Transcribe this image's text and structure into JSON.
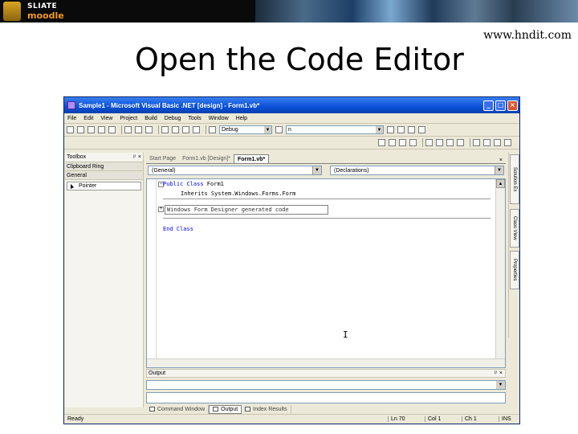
{
  "banner": {
    "logo_top": "SLIATE",
    "logo_bottom": "moodle"
  },
  "site_url": "www.hndit.com",
  "slide_title": "Open the Code Editor",
  "ide": {
    "title": "Sample1 - Microsoft Visual Basic .NET [design] - Form1.vb*",
    "menu": [
      "File",
      "Edit",
      "View",
      "Project",
      "Build",
      "Debug",
      "Tools",
      "Window",
      "Help"
    ],
    "config_combo": "Debug",
    "search_combo": "n",
    "toolbox": {
      "header": "Toolbox",
      "category_clipboard": "Clipboard Ring",
      "category_general": "General",
      "tool_pointer": "Pointer"
    },
    "tabs": [
      "Start Page",
      "Form1.vb [Design]*",
      "Form1.vb*"
    ],
    "class_combo": "(General)",
    "method_combo": "(Declarations)",
    "code": {
      "line1_keyword": "Public Class",
      "line1_name": "Form1",
      "line2": "Inherits System.Windows.Forms.Form",
      "region": "Windows Form Designer generated code",
      "line4": "End Class"
    },
    "side_tabs": [
      "Solution Ex",
      "Class View",
      "Properties"
    ],
    "output": {
      "header": "Output"
    },
    "bottom_tabs": [
      "Command Window",
      "Output",
      "Index Results"
    ],
    "status": {
      "ready": "Ready",
      "line": "Ln 70",
      "col": "Col 1",
      "ch": "Ch 1",
      "ins": "INS"
    }
  }
}
